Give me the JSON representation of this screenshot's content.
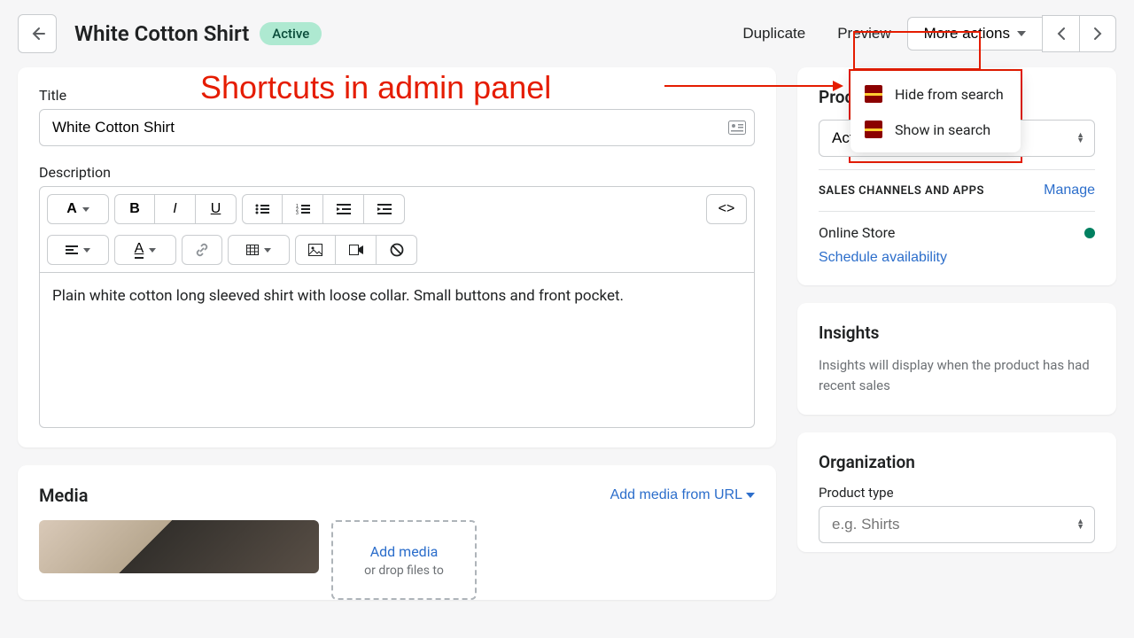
{
  "header": {
    "title": "White Cotton Shirt",
    "statusBadge": "Active",
    "duplicate": "Duplicate",
    "preview": "Preview",
    "moreActions": "More actions"
  },
  "dropdown": {
    "hide": "Hide from search",
    "show": "Show in search"
  },
  "annotation": "Shortcuts in admin panel",
  "main": {
    "titleLabel": "Title",
    "titleValue": "White Cotton Shirt",
    "descriptionLabel": "Description",
    "descriptionValue": "Plain white cotton long sleeved shirt with loose collar. Small buttons and front pocket."
  },
  "media": {
    "sectionTitle": "Media",
    "addFromUrl": "Add media from URL",
    "addMedia": "Add media",
    "dropHint": "or drop files to"
  },
  "sideStatus": {
    "title": "Product sta",
    "selected": "Active"
  },
  "channels": {
    "label": "SALES CHANNELS AND APPS",
    "manage": "Manage",
    "store": "Online Store",
    "schedule": "Schedule availability"
  },
  "insights": {
    "title": "Insights",
    "body": "Insights will display when the product has had recent sales"
  },
  "organization": {
    "title": "Organization",
    "typeLabel": "Product type",
    "typePlaceholder": "e.g. Shirts"
  }
}
